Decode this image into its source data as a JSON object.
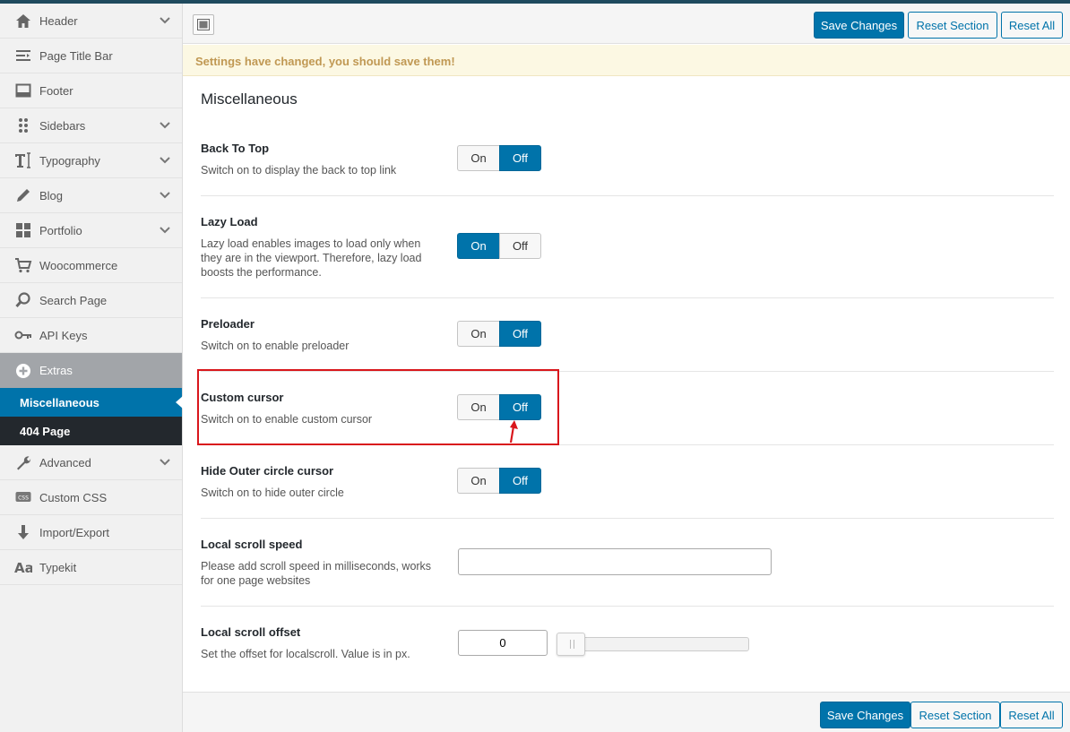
{
  "sidebar": {
    "items": [
      {
        "label": "Header",
        "icon": "home-icon"
      },
      {
        "label": "Page Title Bar",
        "icon": "title-bar-icon"
      },
      {
        "label": "Footer",
        "icon": "footer-icon"
      },
      {
        "label": "Sidebars",
        "icon": "sidebars-icon"
      },
      {
        "label": "Typography",
        "icon": "typography-icon"
      },
      {
        "label": "Blog",
        "icon": "pencil-icon"
      },
      {
        "label": "Portfolio",
        "icon": "grid-icon"
      },
      {
        "label": "Woocommerce",
        "icon": "cart-icon"
      },
      {
        "label": "Search Page",
        "icon": "search-icon"
      },
      {
        "label": "API Keys",
        "icon": "key-icon"
      },
      {
        "label": "Extras",
        "icon": "plus-circle-icon"
      },
      {
        "label": "Miscellaneous"
      },
      {
        "label": "404 Page"
      },
      {
        "label": "Advanced",
        "icon": "wrench-icon"
      },
      {
        "label": "Custom CSS",
        "icon": "css-icon"
      },
      {
        "label": "Import/Export",
        "icon": "download-arrow-icon"
      },
      {
        "label": "Typekit",
        "icon": "font-aa-icon"
      }
    ]
  },
  "toolbar": {
    "save_label": "Save Changes",
    "reset_section_label": "Reset Section",
    "reset_all_label": "Reset All"
  },
  "notice": "Settings have changed, you should save them!",
  "section_title": "Miscellaneous",
  "switch_labels": {
    "on": "On",
    "off": "Off"
  },
  "settings": [
    {
      "title": "Back To Top",
      "desc": "Switch on to display the back to top link",
      "value": "Off"
    },
    {
      "title": "Lazy Load",
      "desc": "Lazy load enables images to load only when they are in the viewport. Therefore, lazy load boosts the performance.",
      "value": "On"
    },
    {
      "title": "Preloader",
      "desc": "Switch on to enable preloader",
      "value": "Off"
    },
    {
      "title": "Custom cursor",
      "desc": "Switch on to enable custom cursor",
      "value": "Off"
    },
    {
      "title": "Hide Outer circle cursor",
      "desc": "Switch on to hide outer circle",
      "value": "Off"
    },
    {
      "title": "Local scroll speed",
      "desc": "Please add scroll speed in milliseconds, works for one page websites",
      "value": ""
    },
    {
      "title": "Local scroll offset",
      "desc": "Set the offset for localscroll. Value is in px.",
      "value": "0",
      "slider_fraction": 0
    }
  ],
  "colors": {
    "accent": "#0073aa",
    "highlight": "#d9161c",
    "notice_text": "#c09853"
  }
}
